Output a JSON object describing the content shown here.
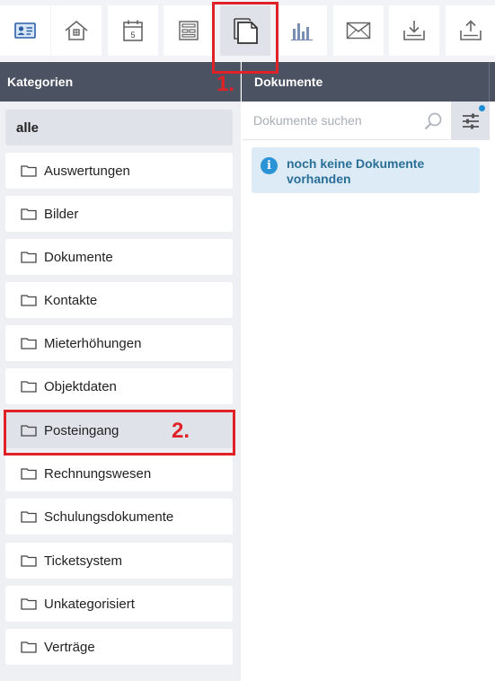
{
  "toolbar": {
    "buttons": [
      {
        "name": "contact-card",
        "icon": "id-card-icon",
        "active": false
      },
      {
        "name": "home",
        "icon": "house-icon",
        "active": false
      },
      {
        "name": "calendar",
        "icon": "calendar-icon",
        "calendar_day": "5",
        "active": false
      },
      {
        "name": "layout",
        "icon": "dashboard-layout-icon",
        "active": false
      },
      {
        "name": "documents",
        "icon": "documents-icon",
        "active": true
      },
      {
        "name": "statistics",
        "icon": "bar-chart-icon",
        "active": false
      },
      {
        "name": "mail",
        "icon": "envelope-icon",
        "active": false
      },
      {
        "name": "download",
        "icon": "tray-download-icon",
        "active": false
      },
      {
        "name": "upload",
        "icon": "tray-upload-icon",
        "active": false
      }
    ]
  },
  "headers": {
    "left": "Kategorien",
    "right": "Dokumente"
  },
  "categories": {
    "all_label": "alle",
    "items": [
      "Auswertungen",
      "Bilder",
      "Dokumente",
      "Kontakte",
      "Mieterhöhungen",
      "Objektdaten",
      "Posteingang",
      "Rechnungswesen",
      "Schulungsdokumente",
      "Ticketsystem",
      "Unkategorisiert",
      "Verträge"
    ]
  },
  "search": {
    "placeholder": "Dokumente suchen",
    "value": ""
  },
  "info": {
    "message_line1": "noch keine Dokumente",
    "message_line2": "vorhanden"
  },
  "annotations": {
    "marker1": "1.",
    "marker2": "2."
  },
  "colors": {
    "header_bg": "#4b5261",
    "accent_blue": "#2a93d5",
    "annotation_red": "#e02127",
    "selected_bg": "#dfe2e9"
  }
}
